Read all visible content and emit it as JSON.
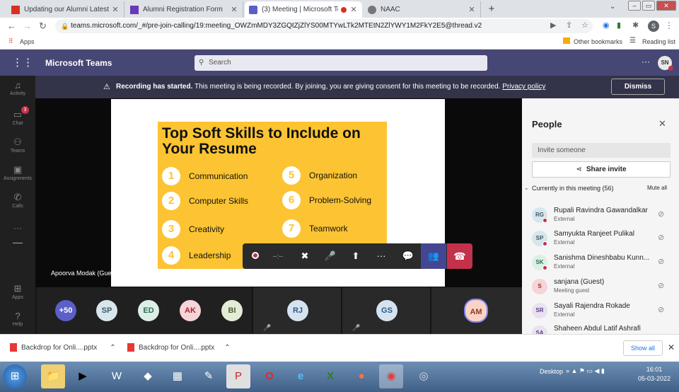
{
  "browser": {
    "tabs": [
      {
        "title": "Updating our Alumni Latest Reco",
        "fav": "#d93025",
        "icon": "gmail-icon"
      },
      {
        "title": "Alumni Registration Form",
        "fav": "#673ab7",
        "icon": "forms-icon"
      },
      {
        "title": "(3) Meeting | Microsoft Teams",
        "fav": "#5b5fc7",
        "icon": "teams-icon"
      },
      {
        "title": "NAAC",
        "fav": "#777777",
        "icon": "globe-icon"
      }
    ],
    "url": "teams.microsoft.com/_#/pre-join-calling/19:meeting_OWZmMDY3ZGQtZjZlYS00MTYwLTk2MTEtN2ZlYWY1M2FkY2E5@thread.v2",
    "profile_initial": "S",
    "apps_label": "Apps",
    "other_bookmarks": "Other bookmarks",
    "reading_list": "Reading list"
  },
  "teams": {
    "app_name": "Microsoft Teams",
    "search_placeholder": "Search",
    "user_initials": "SN",
    "banner": {
      "bold": "Recording has started.",
      "text": "This meeting is being recorded. By joining, you are giving consent for this meeting to be recorded.",
      "link": "Privacy policy",
      "dismiss": "Dismiss"
    },
    "rail": [
      {
        "label": "Activity",
        "icon": "bell-icon",
        "glyph": "🔔"
      },
      {
        "label": "Chat",
        "icon": "chat-icon",
        "glyph": "💬",
        "badge": "3"
      },
      {
        "label": "Teams",
        "icon": "teams-icon",
        "glyph": "👥"
      },
      {
        "label": "Assignments",
        "icon": "assignments-icon",
        "glyph": "📋"
      },
      {
        "label": "Calls",
        "icon": "phone-icon",
        "glyph": "📞"
      },
      {
        "label": "Apps",
        "icon": "apps-icon",
        "glyph": "⊞"
      },
      {
        "label": "Help",
        "icon": "help-icon",
        "glyph": "?"
      }
    ],
    "more": "···",
    "slide": {
      "title": "Top Soft Skills to Include on Your Resume",
      "skills": [
        {
          "n": "1",
          "t": "Communication"
        },
        {
          "n": "2",
          "t": "Computer Skills"
        },
        {
          "n": "3",
          "t": "Creativity"
        },
        {
          "n": "4",
          "t": "Leadership"
        },
        {
          "n": "5",
          "t": "Organization"
        },
        {
          "n": "6",
          "t": "Problem-Solving"
        },
        {
          "n": "7",
          "t": "Teamwork"
        }
      ]
    },
    "speaker": "Apoorva Modak (Guest)",
    "call_timer": "--:--",
    "participants_strip": [
      {
        "i": "+50",
        "bg": "#5b5fc7",
        "fg": "#ffffff"
      },
      {
        "i": "SP",
        "bg": "#d8e6ec",
        "fg": "#3d5a6c"
      },
      {
        "i": "ED",
        "bg": "#dcefe6",
        "fg": "#2f6e4e"
      },
      {
        "i": "AK",
        "bg": "#f6d4d8",
        "fg": "#a4262c"
      },
      {
        "i": "BI",
        "bg": "#e2ecd7",
        "fg": "#4a6630"
      },
      {
        "i": "RJ",
        "bg": "#d5e3f0",
        "fg": "#2b5a84"
      },
      {
        "i": "GS",
        "bg": "#d5e3f0",
        "fg": "#2b5a84"
      },
      {
        "i": "AM",
        "bg": "#fbd3c6",
        "fg": "#8e3a1f"
      }
    ],
    "people": {
      "title": "People",
      "invite_placeholder": "Invite someone",
      "share": "Share invite",
      "section": "Currently in this meeting (56)",
      "mute_all": "Mute all",
      "list": [
        {
          "i": "RG",
          "name": "Rupali Ravindra Gawandalkar",
          "sub": "External",
          "bg": "#d8e6ec",
          "fg": "#3d5a6c"
        },
        {
          "i": "SP",
          "name": "Samyukta Ranjeet Pulikal",
          "sub": "External",
          "bg": "#d8e6ec",
          "fg": "#3d5a6c"
        },
        {
          "i": "SK",
          "name": "Sanishma Dineshbabu Kunn...",
          "sub": "External",
          "bg": "#dcefe6",
          "fg": "#2f6e4e"
        },
        {
          "i": "S",
          "name": "sanjana (Guest)",
          "sub": "Meeting guest",
          "bg": "#f6d4d8",
          "fg": "#a4262c"
        },
        {
          "i": "SR",
          "name": "Sayali Rajendra Rokade",
          "sub": "External",
          "bg": "#e8e1f0",
          "fg": "#5c3e85"
        },
        {
          "i": "SA",
          "name": "Shaheen Abdul Latif Ashrafi",
          "sub": "",
          "bg": "#e8e1f0",
          "fg": "#5c3e85"
        }
      ]
    }
  },
  "downloads": {
    "items": [
      "Backdrop for Onli....pptx",
      "Backdrop for Onli....pptx"
    ],
    "show_all": "Show all"
  },
  "taskbar": {
    "desktop": "Desktop",
    "time": "16:01",
    "date": "05-03-2022"
  }
}
